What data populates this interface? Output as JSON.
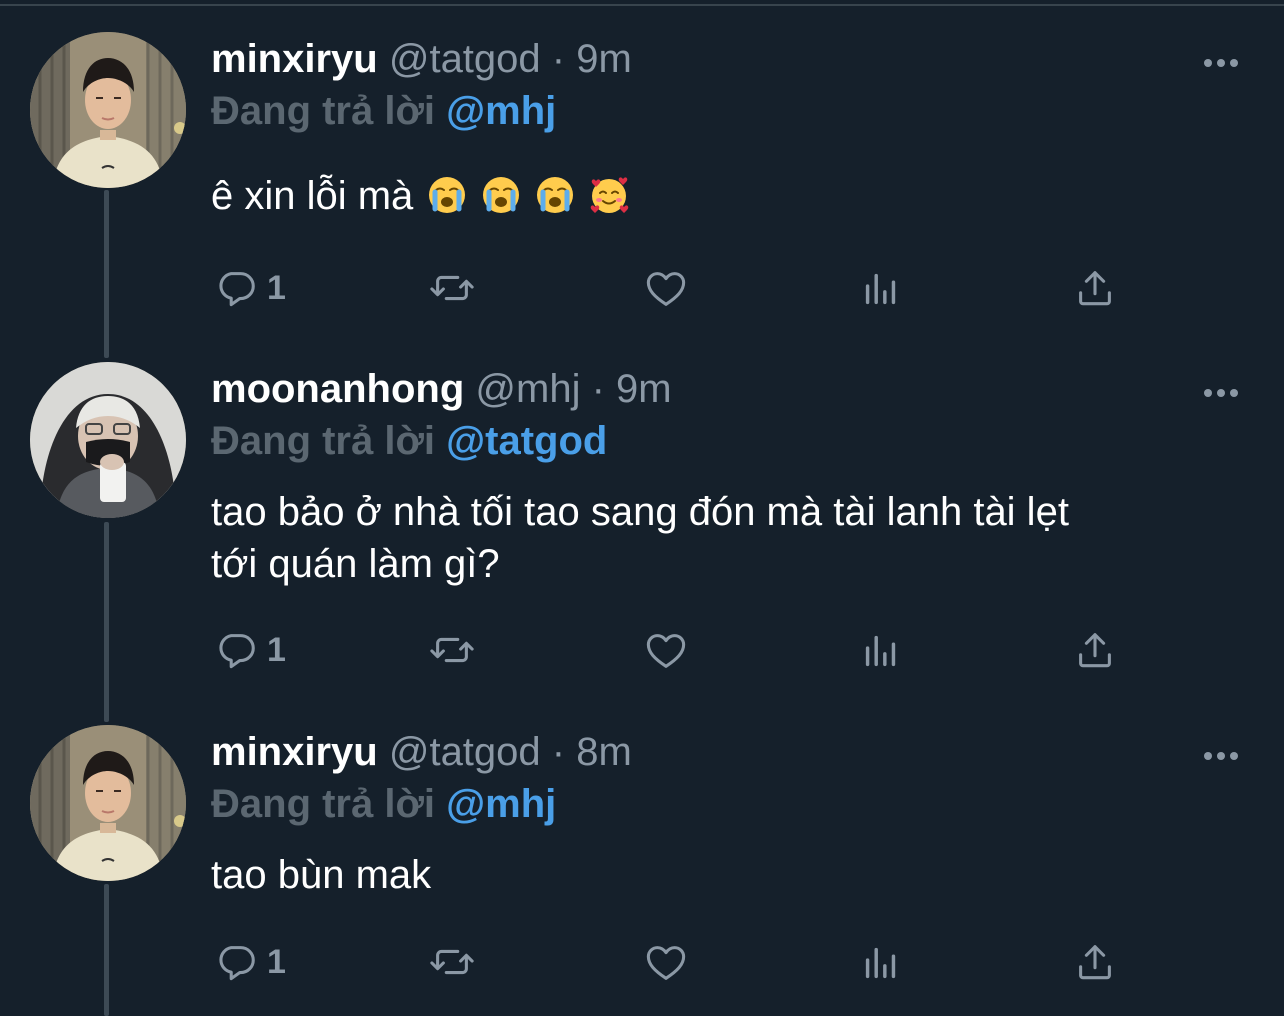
{
  "thread": [
    {
      "display_name": "minxiryu",
      "handle": "@tatgod",
      "separator": "·",
      "time": "9m",
      "reply_prefix": "Đang trả lời",
      "reply_to": "@mhj",
      "text": "ê xin lỗi mà",
      "emojis": [
        "loudly-crying-face",
        "loudly-crying-face",
        "loudly-crying-face",
        "smiling-face-with-hearts"
      ],
      "reply_count": "1",
      "avatar": "photo-person-tshirt"
    },
    {
      "display_name": "moonanhong",
      "handle": "@mhj",
      "separator": "·",
      "time": "9m",
      "reply_prefix": "Đang trả lời",
      "reply_to": "@tatgod",
      "text_line1": "tao bảo ở nhà tối tao sang đón mà tài lanh tài lẹt",
      "text_line2": "tới quán làm gì?",
      "reply_count": "1",
      "avatar": "photo-person-hood-mask"
    },
    {
      "display_name": "minxiryu",
      "handle": "@tatgod",
      "separator": "·",
      "time": "8m",
      "reply_prefix": "Đang trả lời",
      "reply_to": "@mhj",
      "text": "tao bùn mak",
      "reply_count": "1",
      "avatar": "photo-person-tshirt"
    }
  ],
  "icons": {
    "reply": "reply-icon",
    "retweet": "retweet-icon",
    "like": "heart-icon",
    "analytics": "analytics-icon",
    "share": "share-icon",
    "more": "more-icon"
  },
  "colors": {
    "background": "#15202b",
    "secondary_text": "#8b98a5",
    "mention": "#4a9fe8",
    "thread_line": "#3d4a55"
  }
}
